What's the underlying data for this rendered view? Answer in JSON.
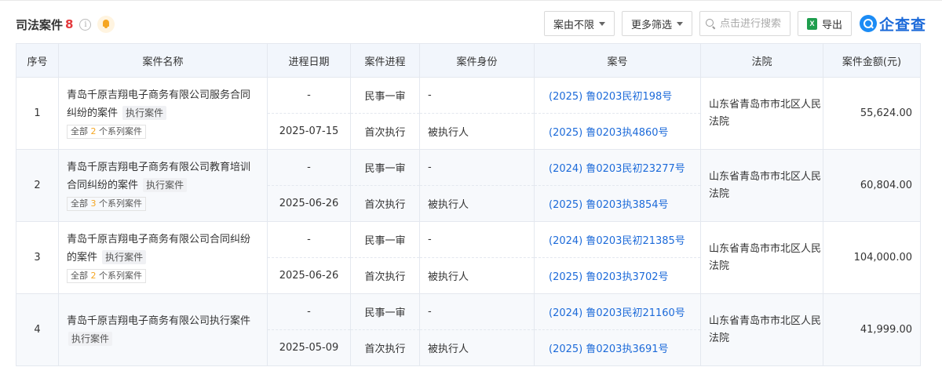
{
  "header": {
    "title": "司法案件",
    "count": "8",
    "info_glyph": "i",
    "filters": [
      {
        "label": "案由不限"
      },
      {
        "label": "更多筛选"
      }
    ],
    "search_placeholder": "点击进行搜索",
    "export_label": "导出",
    "excel_glyph": "X",
    "logo_text": "企查查"
  },
  "table": {
    "columns": [
      "序号",
      "案件名称",
      "进程日期",
      "案件进程",
      "案件身份",
      "案号",
      "法院",
      "案件金额(元)"
    ],
    "rows": [
      {
        "index": "1",
        "name": "青岛千原吉翔电子商务有限公司服务合同纠纷的案件",
        "tag": "执行案件",
        "series_prefix": "全部",
        "series_count": "2",
        "series_suffix": "个系列案件",
        "stages": [
          {
            "date": "-",
            "progress": "民事一审",
            "role": "-",
            "case_no": "(2025) 鲁0203民初198号"
          },
          {
            "date": "2025-07-15",
            "progress": "首次执行",
            "role": "被执行人",
            "case_no": "(2025) 鲁0203执4860号"
          }
        ],
        "court": "山东省青岛市市北区人民法院",
        "amount": "55,624.00"
      },
      {
        "index": "2",
        "name": "青岛千原吉翔电子商务有限公司教育培训合同纠纷的案件",
        "tag": "执行案件",
        "series_prefix": "全部",
        "series_count": "3",
        "series_suffix": "个系列案件",
        "stages": [
          {
            "date": "-",
            "progress": "民事一审",
            "role": "-",
            "case_no": "(2024) 鲁0203民初23277号"
          },
          {
            "date": "2025-06-26",
            "progress": "首次执行",
            "role": "被执行人",
            "case_no": "(2025) 鲁0203执3854号"
          }
        ],
        "court": "山东省青岛市市北区人民法院",
        "amount": "60,804.00"
      },
      {
        "index": "3",
        "name": "青岛千原吉翔电子商务有限公司合同纠纷的案件",
        "tag": "执行案件",
        "series_prefix": "全部",
        "series_count": "2",
        "series_suffix": "个系列案件",
        "stages": [
          {
            "date": "-",
            "progress": "民事一审",
            "role": "-",
            "case_no": "(2024) 鲁0203民初21385号"
          },
          {
            "date": "2025-06-26",
            "progress": "首次执行",
            "role": "被执行人",
            "case_no": "(2025) 鲁0203执3702号"
          }
        ],
        "court": "山东省青岛市市北区人民法院",
        "amount": "104,000.00"
      },
      {
        "index": "4",
        "name": "青岛千原吉翔电子商务有限公司执行案件",
        "tag": "执行案件",
        "stages": [
          {
            "date": "-",
            "progress": "民事一审",
            "role": "-",
            "case_no": "(2024) 鲁0203民初21160号"
          },
          {
            "date": "2025-05-09",
            "progress": "首次执行",
            "role": "被执行人",
            "case_no": "(2025) 鲁0203执3691号"
          }
        ],
        "court": "山东省青岛市市北区人民法院",
        "amount": "41,999.00"
      }
    ]
  }
}
